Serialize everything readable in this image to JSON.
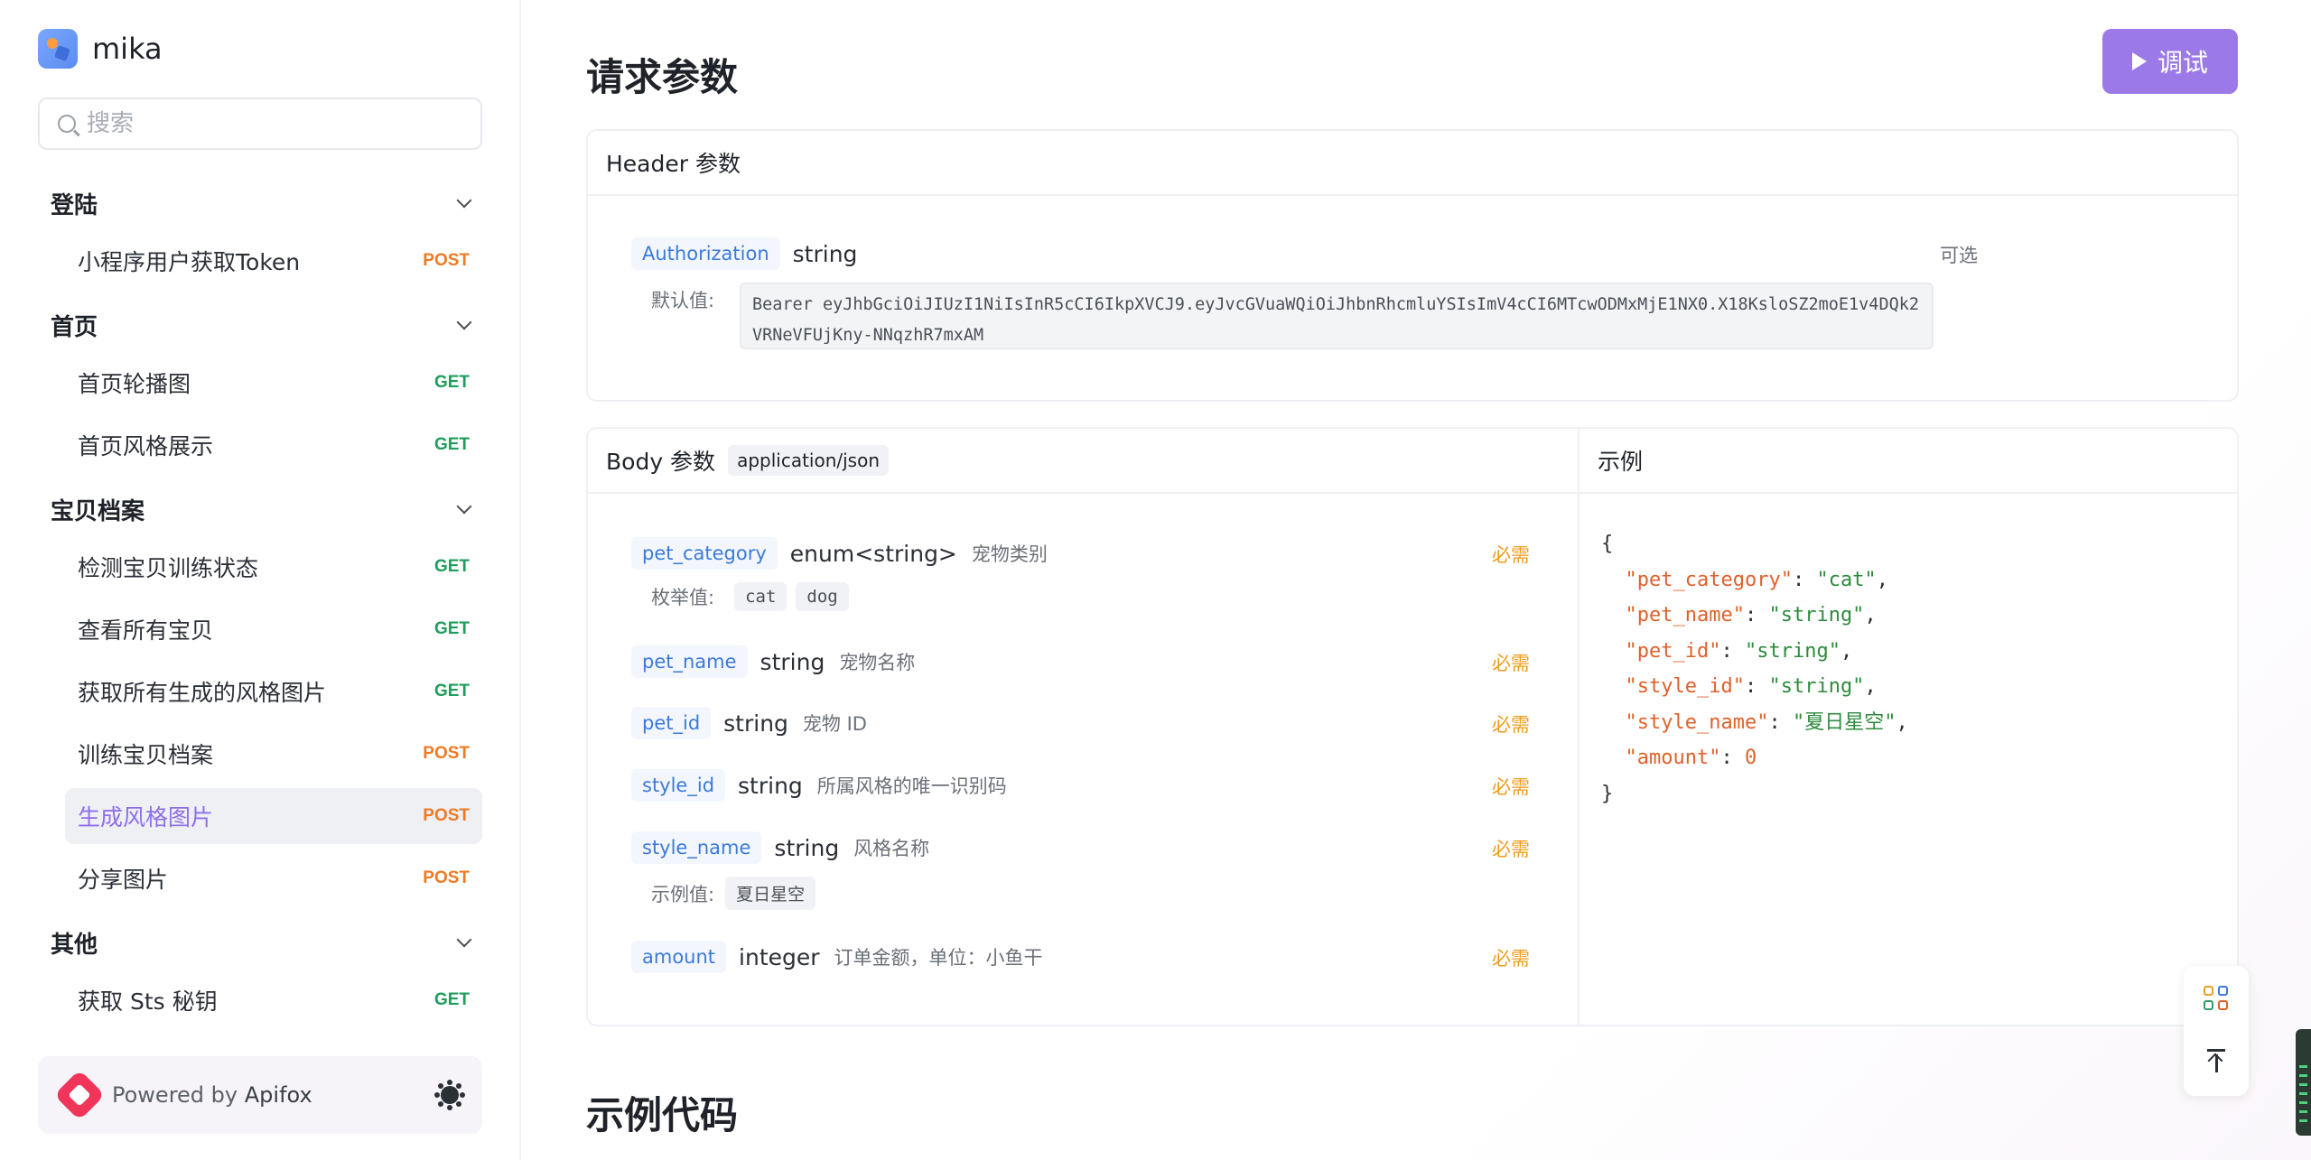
{
  "brand": {
    "name": "mika"
  },
  "search": {
    "placeholder": "搜索"
  },
  "sidebar": {
    "groups": [
      {
        "title": "登陆",
        "items": [
          {
            "label": "小程序用户获取Token",
            "method": "POST"
          }
        ]
      },
      {
        "title": "首页",
        "items": [
          {
            "label": "首页轮播图",
            "method": "GET"
          },
          {
            "label": "首页风格展示",
            "method": "GET"
          }
        ]
      },
      {
        "title": "宝贝档案",
        "items": [
          {
            "label": "检测宝贝训练状态",
            "method": "GET"
          },
          {
            "label": "查看所有宝贝",
            "method": "GET"
          },
          {
            "label": "获取所有生成的风格图片",
            "method": "GET"
          },
          {
            "label": "训练宝贝档案",
            "method": "POST"
          },
          {
            "label": "生成风格图片",
            "method": "POST",
            "active": true
          },
          {
            "label": "分享图片",
            "method": "POST"
          }
        ]
      },
      {
        "title": "其他",
        "items": [
          {
            "label": "获取 Sts 秘钥",
            "method": "GET"
          }
        ]
      }
    ],
    "powered": {
      "prefix": "Powered by",
      "name": "Apifox"
    }
  },
  "main": {
    "title": "请求参数",
    "debug_label": "调试",
    "header_params": {
      "heading": "Header 参数",
      "param": {
        "name": "Authorization",
        "type": "string",
        "optional": "可选",
        "default_label": "默认值:",
        "default_value": "Bearer eyJhbGciOiJIUzI1NiIsInR5cCI6IkpXVCJ9.eyJvcGVuaWQiOiJhbnRhcmluYSIsImV4cCI6MTcwODMxMjE1NX0.X18KsloSZ2moE1v4DQk2VRNeVFUjKny-NNqzhR7mxAM"
      }
    },
    "body_params": {
      "heading": "Body 参数",
      "content_type": "application/json",
      "required_label": "必需",
      "enum_label": "枚举值:",
      "example_label": "示例值:",
      "params": [
        {
          "name": "pet_category",
          "type": "enum<string>",
          "desc": "宠物类别",
          "enum": [
            "cat",
            "dog"
          ]
        },
        {
          "name": "pet_name",
          "type": "string",
          "desc": "宠物名称"
        },
        {
          "name": "pet_id",
          "type": "string",
          "desc": "宠物 ID"
        },
        {
          "name": "style_id",
          "type": "string",
          "desc": "所属风格的唯一识别码"
        },
        {
          "name": "style_name",
          "type": "string",
          "desc": "风格名称",
          "example": "夏日星空"
        },
        {
          "name": "amount",
          "type": "integer",
          "desc": "订单金额，单位：小鱼干"
        }
      ]
    },
    "example": {
      "heading": "示例",
      "fields": [
        {
          "key": "pet_category",
          "value": "\"cat\"",
          "kind": "string"
        },
        {
          "key": "pet_name",
          "value": "\"string\"",
          "kind": "string"
        },
        {
          "key": "pet_id",
          "value": "\"string\"",
          "kind": "string"
        },
        {
          "key": "style_id",
          "value": "\"string\"",
          "kind": "string"
        },
        {
          "key": "style_name",
          "value": "\"夏日星空\"",
          "kind": "string"
        },
        {
          "key": "amount",
          "value": "0",
          "kind": "number"
        }
      ]
    },
    "section2_title": "示例代码"
  },
  "colors": {
    "accent": "#9b7ae8",
    "post": "#f07a24",
    "get": "#1f9d5b",
    "required": "#f09a1a",
    "param_name": "#3b7ad9"
  }
}
